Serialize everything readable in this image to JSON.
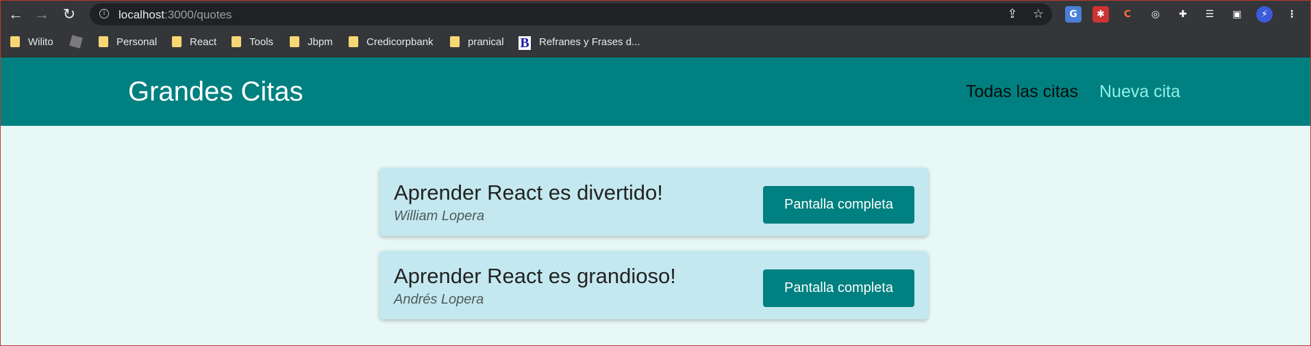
{
  "browser": {
    "url_host": "localhost",
    "url_path": ":3000/quotes",
    "bookmarks": [
      "Wilito",
      "Personal",
      "React",
      "Tools",
      "Jbpm",
      "Credicorpbank",
      "pranical",
      "Refranes y Frases d..."
    ],
    "icons": [
      "back-icon",
      "forward-icon",
      "reload-icon",
      "info-icon",
      "share-icon",
      "star-icon",
      "translate-icon",
      "extension-icon",
      "kebab-menu-icon"
    ]
  },
  "app": {
    "title": "Grandes Citas",
    "nav": {
      "all": "Todas las citas",
      "new": "Nueva cita"
    }
  },
  "quotes": [
    {
      "text": "Aprender React es divertido!",
      "author": "William Lopera",
      "button": "Pantalla completa"
    },
    {
      "text": "Aprender React es grandioso!",
      "author": "Andrés Lopera",
      "button": "Pantalla completa"
    }
  ],
  "colors": {
    "header": "#008080",
    "page_bg": "#e8f8f7",
    "card_bg": "#c4e8ef",
    "active_link": "#8ff0e6"
  }
}
